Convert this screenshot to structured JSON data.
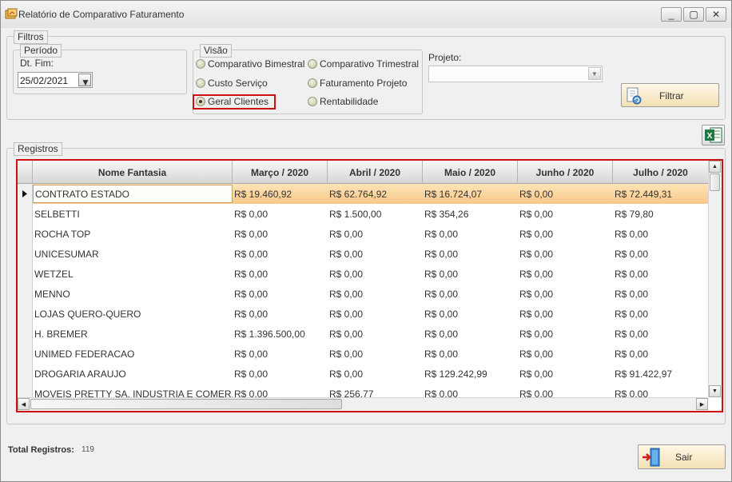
{
  "window": {
    "title": "Relatório de Comparativo Faturamento",
    "controls": [
      "_",
      "▢",
      "✕"
    ]
  },
  "filters": {
    "legend": "Filtros",
    "period": {
      "legend": "Período",
      "end_date_label": "Dt. Fim:",
      "end_date_value": "25/02/2021"
    },
    "view": {
      "legend": "Visão",
      "options": [
        {
          "label": "Comparativo Bimestral",
          "selected": false
        },
        {
          "label": "Comparativo Trimestral",
          "selected": false
        },
        {
          "label": "Custo Serviço",
          "selected": false
        },
        {
          "label": "Faturamento Projeto",
          "selected": false
        },
        {
          "label": "Geral Clientes",
          "selected": true
        },
        {
          "label": "Rentabilidade",
          "selected": false
        }
      ]
    },
    "project": {
      "label": "Projeto:",
      "value": ""
    },
    "filter_button": "Filtrar"
  },
  "records": {
    "legend": "Registros",
    "columns": [
      "Nome Fantasia",
      "Março / 2020",
      "Abril / 2020",
      "Maio / 2020",
      "Junho / 2020",
      "Julho / 2020"
    ],
    "rows": [
      [
        "CONTRATO ESTADO",
        "R$ 19.460,92",
        "R$ 62.764,92",
        "R$ 16.724,07",
        "R$ 0,00",
        "R$ 72.449,31"
      ],
      [
        "SELBETTI",
        "R$ 0,00",
        "R$ 1.500,00",
        "R$ 354,26",
        "R$ 0,00",
        "R$ 79,80"
      ],
      [
        "ROCHA TOP",
        "R$ 0,00",
        "R$ 0,00",
        "R$ 0,00",
        "R$ 0,00",
        "R$ 0,00"
      ],
      [
        "UNICESUMAR",
        "R$ 0,00",
        "R$ 0,00",
        "R$ 0,00",
        "R$ 0,00",
        "R$ 0,00"
      ],
      [
        "WETZEL",
        "R$ 0,00",
        "R$ 0,00",
        "R$ 0,00",
        "R$ 0,00",
        "R$ 0,00"
      ],
      [
        "MENNO",
        "R$ 0,00",
        "R$ 0,00",
        "R$ 0,00",
        "R$ 0,00",
        "R$ 0,00"
      ],
      [
        "LOJAS QUERO-QUERO",
        "R$ 0,00",
        "R$ 0,00",
        "R$ 0,00",
        "R$ 0,00",
        "R$ 0,00"
      ],
      [
        "H. BREMER",
        "R$ 1.396.500,00",
        "R$ 0,00",
        "R$ 0,00",
        "R$ 0,00",
        "R$ 0,00"
      ],
      [
        "UNIMED FEDERACAO",
        "R$ 0,00",
        "R$ 0,00",
        "R$ 0,00",
        "R$ 0,00",
        "R$ 0,00"
      ],
      [
        "DROGARIA ARAUJO",
        "R$ 0,00",
        "R$ 0,00",
        "R$ 129.242,99",
        "R$ 0,00",
        "R$ 91.422,97"
      ],
      [
        "MOVEIS PRETTY SA. INDUSTRIA E COMER...",
        "R$ 0,00",
        "R$ 256,77",
        "R$ 0,00",
        "R$ 0,00",
        "R$ 0,00"
      ]
    ],
    "selected_row": 0
  },
  "footer": {
    "total_label": "Total Registros:",
    "total_value": "119",
    "exit_button": "Sair"
  },
  "icons": {
    "title": "report-icon",
    "filter": "refresh-doc-icon",
    "excel": "excel-icon",
    "exit": "exit-door-icon"
  }
}
